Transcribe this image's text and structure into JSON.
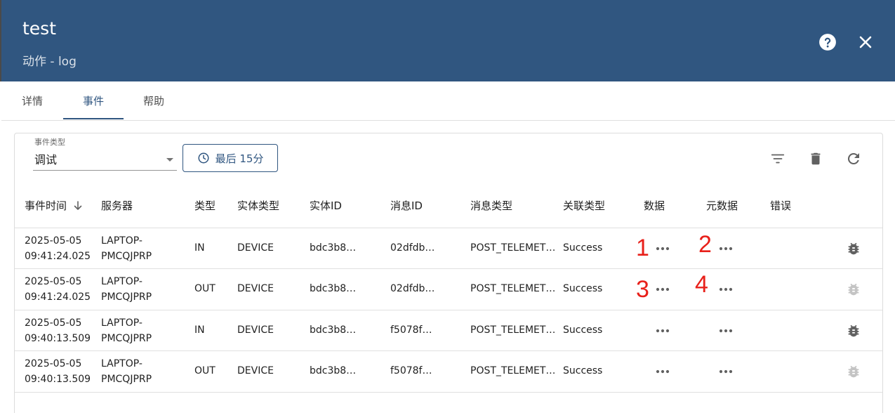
{
  "dialog": {
    "title": "test",
    "subtitle": "动作 - log"
  },
  "tabs": [
    {
      "label": "详情",
      "active": false
    },
    {
      "label": "事件",
      "active": true
    },
    {
      "label": "帮助",
      "active": false
    }
  ],
  "filter": {
    "event_type_label": "事件类型",
    "event_type_value": "调试",
    "time_range_label": "最后 15分"
  },
  "table": {
    "columns": [
      "事件时间",
      "服务器",
      "类型",
      "实体类型",
      "实体ID",
      "消息ID",
      "消息类型",
      "关联类型",
      "数据",
      "元数据",
      "错误"
    ],
    "rows": [
      {
        "date": "2025-05-05",
        "time": "09:41:24.025",
        "server_1": "LAPTOP-",
        "server_2": "PMCQJPRP",
        "type": "IN",
        "entity_type": "DEVICE",
        "entity_id": "bdc3b8…",
        "message_id": "02dfdb…",
        "message_type": "POST_TELEMET…",
        "relation_type": "Success",
        "error": "",
        "debug_enabled": true
      },
      {
        "date": "2025-05-05",
        "time": "09:41:24.025",
        "server_1": "LAPTOP-",
        "server_2": "PMCQJPRP",
        "type": "OUT",
        "entity_type": "DEVICE",
        "entity_id": "bdc3b8…",
        "message_id": "02dfdb…",
        "message_type": "POST_TELEMET…",
        "relation_type": "Success",
        "error": "",
        "debug_enabled": false
      },
      {
        "date": "2025-05-05",
        "time": "09:40:13.509",
        "server_1": "LAPTOP-",
        "server_2": "PMCQJPRP",
        "type": "IN",
        "entity_type": "DEVICE",
        "entity_id": "bdc3b8…",
        "message_id": "f5078f…",
        "message_type": "POST_TELEMET…",
        "relation_type": "Success",
        "error": "",
        "debug_enabled": true
      },
      {
        "date": "2025-05-05",
        "time": "09:40:13.509",
        "server_1": "LAPTOP-",
        "server_2": "PMCQJPRP",
        "type": "OUT",
        "entity_type": "DEVICE",
        "entity_id": "bdc3b8…",
        "message_id": "f5078f…",
        "message_type": "POST_TELEMET…",
        "relation_type": "Success",
        "error": "",
        "debug_enabled": false
      }
    ]
  },
  "annotations": [
    "1",
    "2",
    "3",
    "4"
  ],
  "icons": {
    "help": "help-circle-icon",
    "close": "close-icon",
    "clock": "clock-icon",
    "filter": "filter-icon",
    "delete": "trash-icon",
    "refresh": "refresh-icon",
    "sort": "arrow-down-icon",
    "more": "more-horiz-icon",
    "debug": "bug-icon"
  },
  "colors": {
    "primary": "#305680",
    "annotation": "#e8201a",
    "bug_active": "#616161",
    "bug_inactive": "#c4c4c4"
  }
}
